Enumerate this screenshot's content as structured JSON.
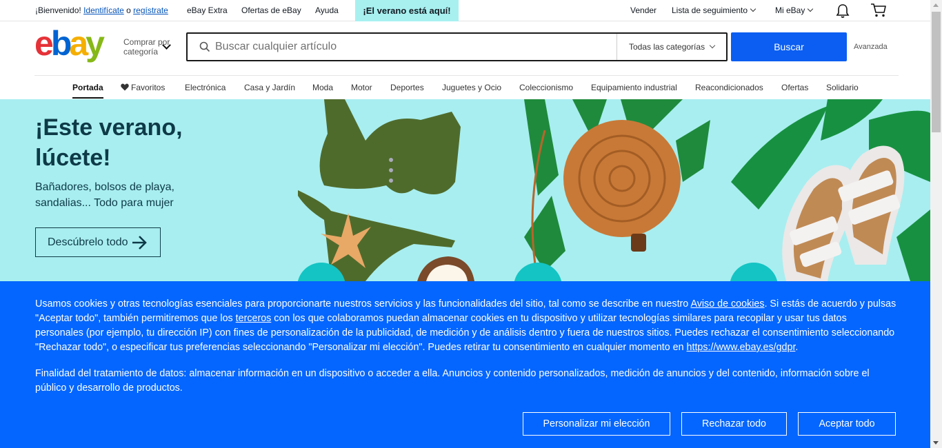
{
  "topbar": {
    "welcome": "¡Bienvenido!",
    "signin": "Identifícate",
    "or": "o",
    "register": "regístrate",
    "links": [
      "eBay Extra",
      "Ofertas de eBay",
      "Ayuda"
    ],
    "promo": "¡El verano está aquí!",
    "sell": "Vender",
    "watchlist": "Lista de seguimiento",
    "myebay": "Mi eBay"
  },
  "header": {
    "logo_letters": [
      "e",
      "b",
      "a",
      "y"
    ],
    "shop_by_line1": "Comprar por",
    "shop_by_line2": "categoría",
    "search_placeholder": "Buscar cualquier artículo",
    "category": "Todas las categorías",
    "search_button": "Buscar",
    "advanced": "Avanzada"
  },
  "nav": {
    "items": [
      "Portada",
      "Favoritos",
      "Electrónica",
      "Casa y Jardín",
      "Moda",
      "Motor",
      "Deportes",
      "Juguetes y Ocio",
      "Coleccionismo",
      "Equipamiento industrial",
      "Reacondicionados",
      "Ofertas",
      "Solidario"
    ]
  },
  "hero": {
    "title_line1": "¡Este verano,",
    "title_line2": "lúcete!",
    "subtitle_line1": "Bañadores, bolsos de playa,",
    "subtitle_line2": "sandalias... Todo para mujer",
    "cta": "Descúbrelo todo"
  },
  "cookie": {
    "p1_a": "Usamos cookies y otras tecnologías esenciales para proporcionarte nuestros servicios y las funcionalidades del sitio, tal como se describe en nuestro ",
    "p1_link1": "Aviso de cookies",
    "p1_b": ". Si estás de acuerdo y pulsas \"Aceptar todo\", también permitiremos que los ",
    "p1_link2": "terceros",
    "p1_c": " con los que colaboramos puedan almacenar cookies en tu dispositivo y utilizar tecnologías similares para recopilar y usar tus datos personales (por ejemplo, tu dirección IP) con fines de personalización de la publicidad, de medición y de análisis dentro y fuera de nuestros sitios. Puedes rechazar el consentimiento seleccionando \"Rechazar todo\", o especificar tus preferencias seleccionando \"Personalizar mi elección\". Puedes retirar tu consentimiento en cualquier momento en ",
    "p1_link3": "https://www.ebay.es/gdpr",
    "p1_d": ".",
    "p2": "Finalidad del tratamiento de datos: almacenar información en un dispositivo o acceder a ella. Anuncios y contenido personalizados, medición de anuncios y del contenido, información sobre el público y desarrollo de productos.",
    "btn_customize": "Personalizar mi elección",
    "btn_reject": "Rechazar todo",
    "btn_accept": "Aceptar todo"
  },
  "colors": {
    "ebay_red": "#e53238",
    "ebay_blue": "#0064d2",
    "ebay_yellow": "#f5af02",
    "ebay_green": "#86b817",
    "search_button": "#0b5ef1",
    "cookie_banner": "#0466fe",
    "hero_bg": "#a8eef0",
    "promo_bg": "#a8f0f0"
  },
  "icons": [
    "search-icon",
    "heart-icon",
    "bell-icon",
    "cart-icon",
    "arrow-right-icon",
    "chevron-down-icon"
  ]
}
